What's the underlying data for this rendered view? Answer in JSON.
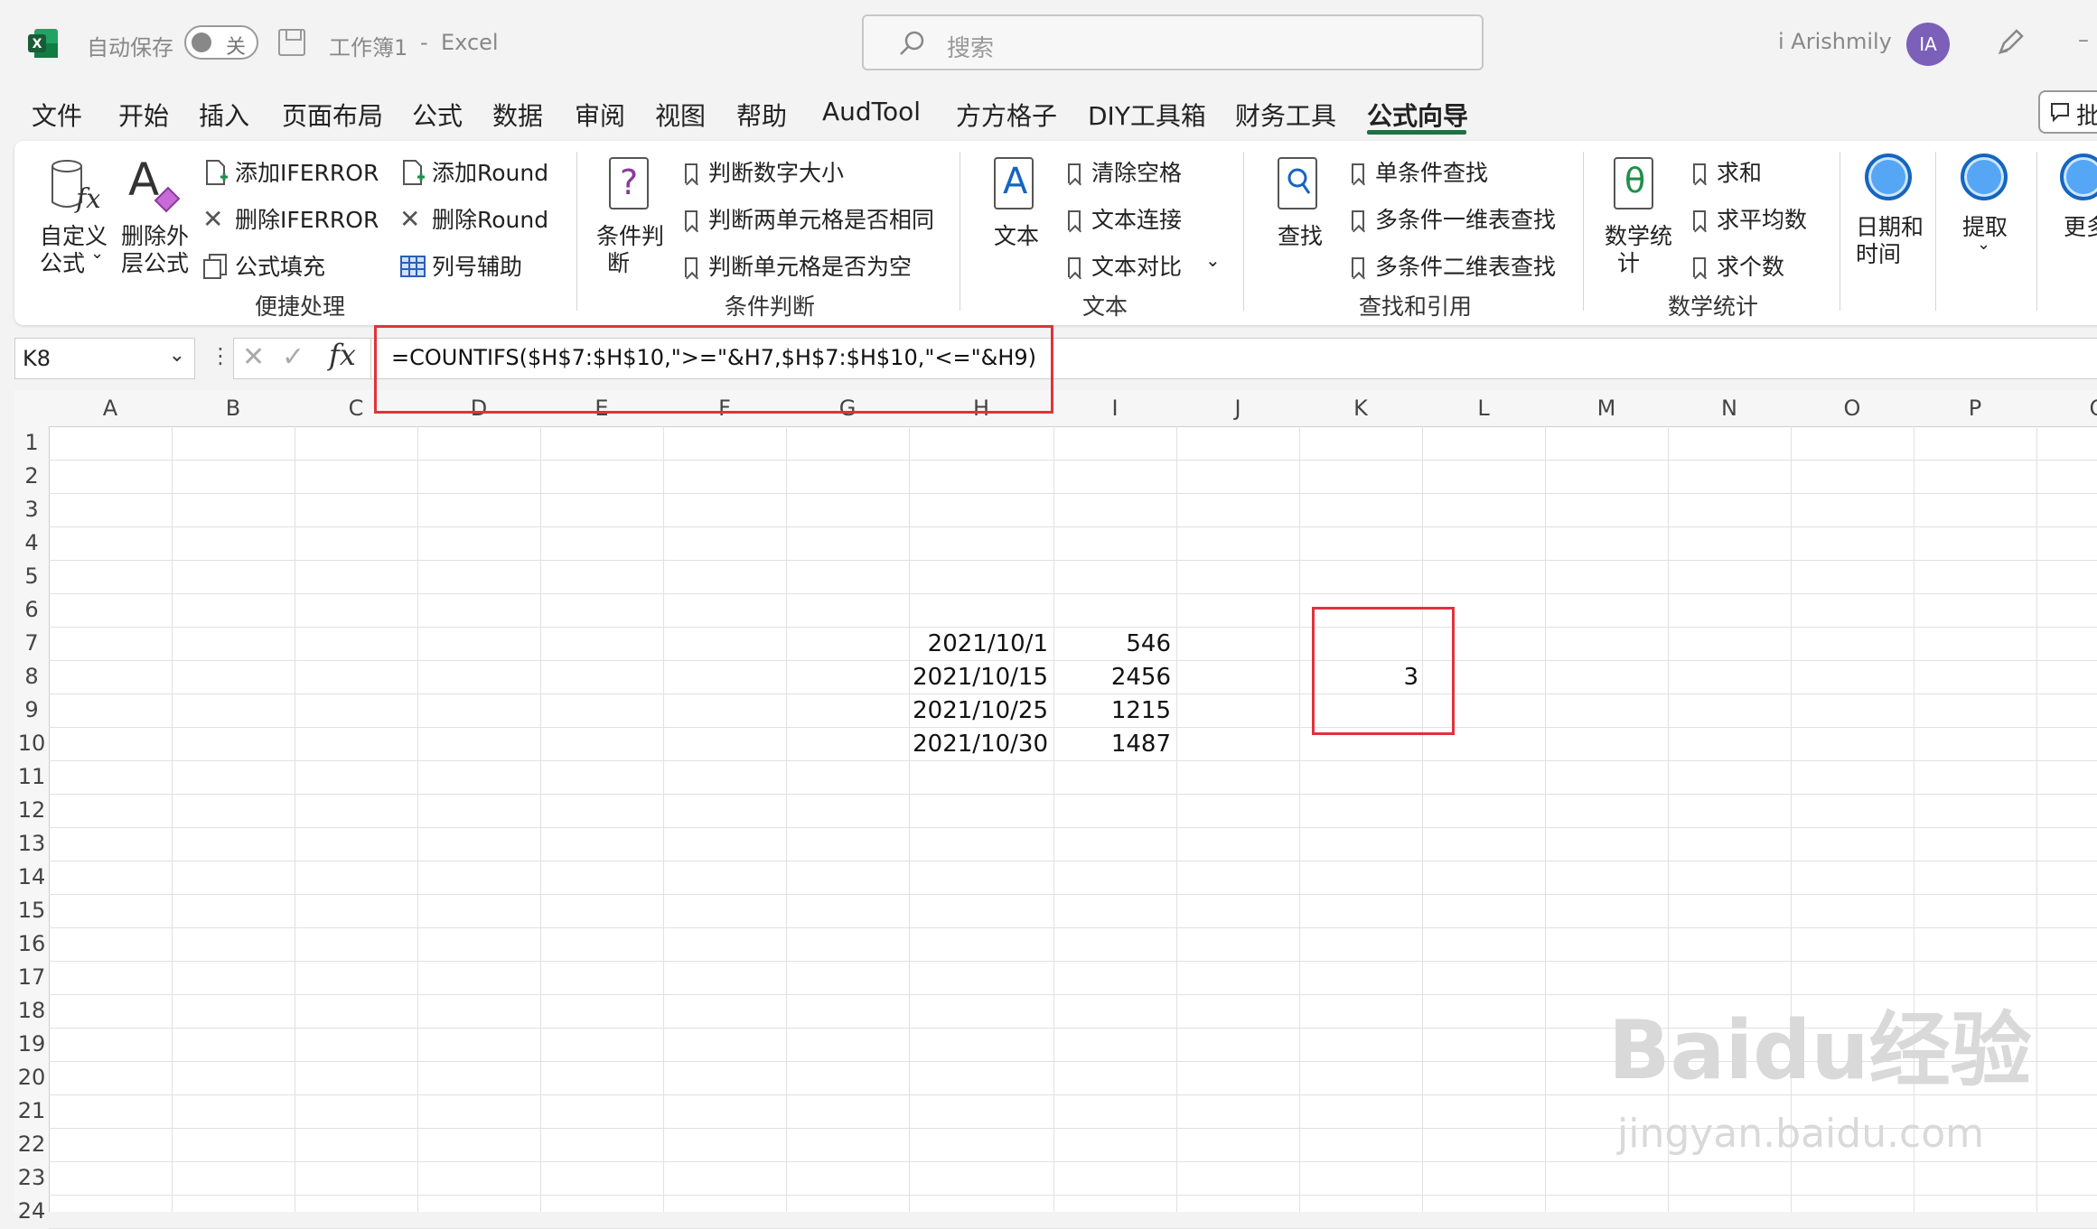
{
  "titlebar": {
    "autosave_label": "自动保存",
    "autosave_state": "关",
    "doc_name": "工作簿1",
    "app_sep": "-",
    "app_name": "Excel",
    "search_placeholder": "搜索",
    "user_name": "i Arishmily",
    "avatar_initials": "IA"
  },
  "tabs": [
    "文件",
    "开始",
    "插入",
    "页面布局",
    "公式",
    "数据",
    "审阅",
    "视图",
    "帮助",
    "AudTool",
    "方方格子",
    "DIY工具箱",
    "财务工具",
    "公式向导"
  ],
  "comment_label": "批",
  "ribbon": {
    "custom_formula_label_1": "自定义",
    "custom_formula_label_2": "公式",
    "remove_layer_label_1": "删除外",
    "remove_layer_label_2": "层公式",
    "add_iferror": "添加IFERROR",
    "del_iferror": "删除IFERROR",
    "formula_fill": "公式填充",
    "add_round": "添加Round",
    "del_round": "删除Round",
    "col_helper": "列号辅助",
    "group_quick": "便捷处理",
    "cond_label_1": "条件判",
    "cond_label_2": "断",
    "judge_num_size": "判断数字大小",
    "judge_two_same": "判断两单元格是否相同",
    "judge_empty": "判断单元格是否为空",
    "group_cond": "条件判断",
    "text_label": "文本",
    "clear_space": "清除空格",
    "text_concat": "文本连接",
    "text_compare": "文本对比",
    "group_text": "文本",
    "lookup_label": "查找",
    "single_lookup": "单条件查找",
    "multi_1d_lookup": "多条件一维表查找",
    "multi_2d_lookup": "多条件二维表查找",
    "group_lookup": "查找和引用",
    "math_label_1": "数学统",
    "math_label_2": "计",
    "sum": "求和",
    "average": "求平均数",
    "count": "求个数",
    "group_math": "数学统计",
    "datetime_label_1": "日期和",
    "datetime_label_2": "时间",
    "extract_label": "提取",
    "more_label": "更多"
  },
  "formula_bar": {
    "cell_ref": "K8",
    "formula": "=COUNTIFS($H$7:$H$10,\">=\"&H7,$H$7:$H$10,\"<=\"&H9)"
  },
  "columns": [
    "A",
    "B",
    "C",
    "D",
    "E",
    "F",
    "G",
    "H",
    "I",
    "J",
    "K",
    "L",
    "M",
    "N",
    "O",
    "P",
    "Q"
  ],
  "rows": [
    "1",
    "2",
    "3",
    "4",
    "5",
    "6",
    "7",
    "8",
    "9",
    "10",
    "11",
    "12",
    "13",
    "14",
    "15",
    "16",
    "17",
    "18",
    "19",
    "20",
    "21",
    "22",
    "23",
    "24"
  ],
  "cells": {
    "H7": "2021/10/1",
    "I7": "546",
    "H8": "2021/10/15",
    "I8": "2456",
    "H9": "2021/10/25",
    "I9": "1215",
    "H10": "2021/10/30",
    "I10": "1487",
    "K8": "3"
  },
  "watermark": {
    "main": "Baidu经验",
    "sub": "jingyan.baidu.com"
  }
}
